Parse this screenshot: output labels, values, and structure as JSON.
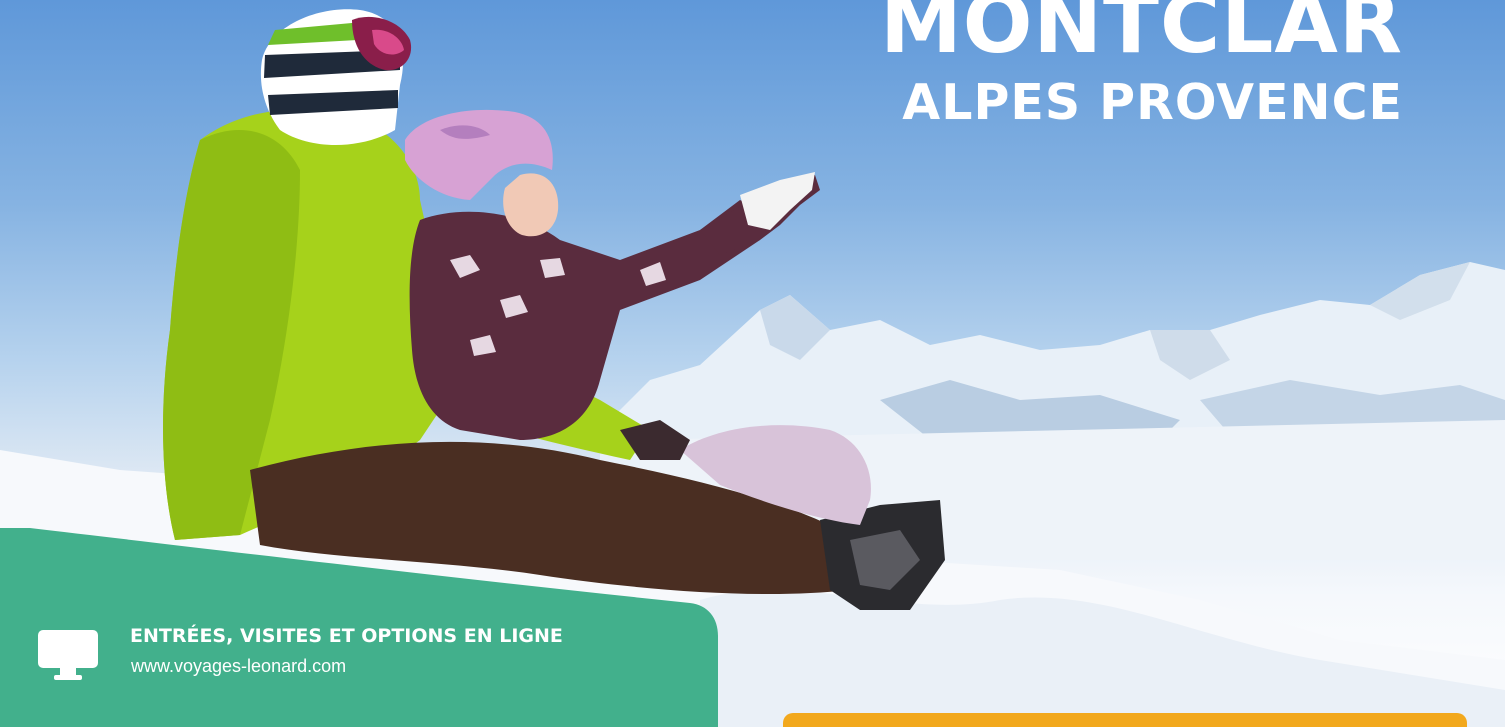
{
  "header": {
    "title": "MONTCLAR",
    "subtitle": "ALPES PROVENCE"
  },
  "info": {
    "title": "ENTRÉES, VISITES ET OPTIONS EN LIGNE",
    "url": "www.voyages-leonard.com",
    "icon": "monitor-icon"
  },
  "colors": {
    "panel": "#42b08c",
    "accent_bar": "#f2a81d",
    "text": "#ffffff",
    "sky_top": "#5f98d9"
  },
  "photo": {
    "subject": "two people sitting in snow, one pointing at snowy mountains"
  }
}
